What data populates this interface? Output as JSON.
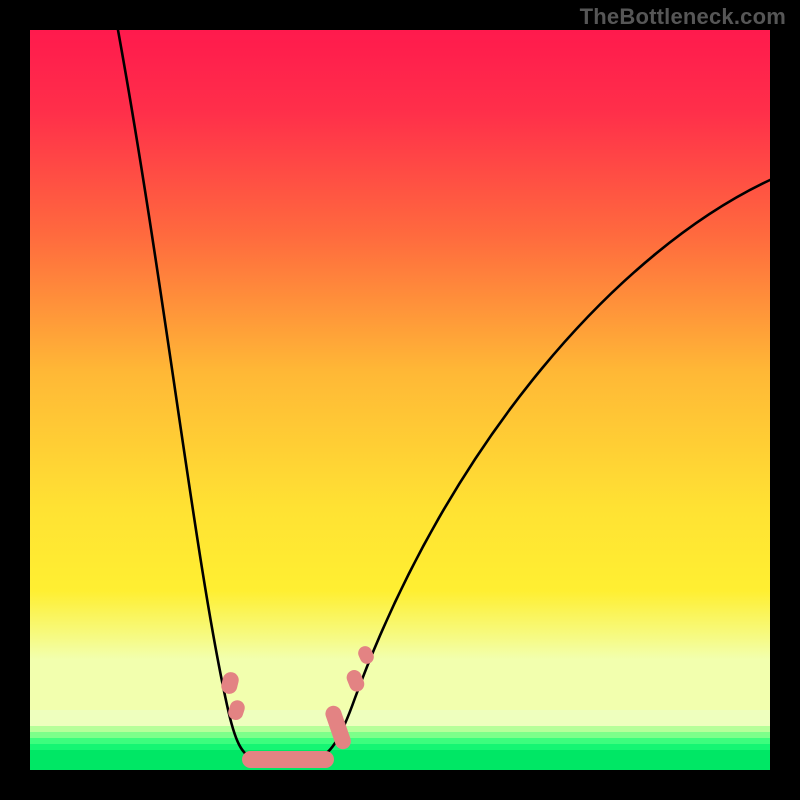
{
  "watermark": "TheBottleneck.com",
  "chart_data": {
    "type": "line",
    "title": "",
    "xlabel": "",
    "ylabel": "",
    "xlim": [
      0,
      100
    ],
    "ylim": [
      0,
      100
    ],
    "grid": false,
    "background_gradient_meaning": "top=red=high bottleneck, bottom=green=no bottleneck",
    "series": [
      {
        "name": "bottleneck-curve",
        "color": "#000000",
        "x": [
          12,
          15,
          18,
          21,
          24,
          26,
          28,
          30,
          33,
          36,
          39,
          42,
          46,
          52,
          60,
          70,
          80,
          90,
          100
        ],
        "y": [
          100,
          80,
          58,
          40,
          22,
          10,
          3,
          1,
          1,
          2,
          6,
          15,
          28,
          45,
          60,
          70,
          76,
          79,
          80
        ]
      }
    ],
    "annotations": [
      {
        "name": "optimal-range-markers",
        "color": "#e38383",
        "x_range": [
          26,
          46
        ],
        "y_range": [
          1,
          18
        ],
        "note": "salmon rounded dashes marking the low-bottleneck valley"
      }
    ],
    "color_bands": [
      {
        "y_range": [
          0,
          2.5
        ],
        "color": "#00e765"
      },
      {
        "y_range": [
          2.5,
          5
        ],
        "color": "#3dfd7e"
      },
      {
        "y_range": [
          5,
          8
        ],
        "color": "#b6ff9a"
      },
      {
        "y_range": [
          8,
          15
        ],
        "color": "#f2ffae"
      },
      {
        "y_range": [
          15,
          40
        ],
        "color": "#ffe233"
      },
      {
        "y_range": [
          40,
          70
        ],
        "color": "#ff8a3a"
      },
      {
        "y_range": [
          70,
          100
        ],
        "color": "#ff1a4d"
      }
    ]
  }
}
